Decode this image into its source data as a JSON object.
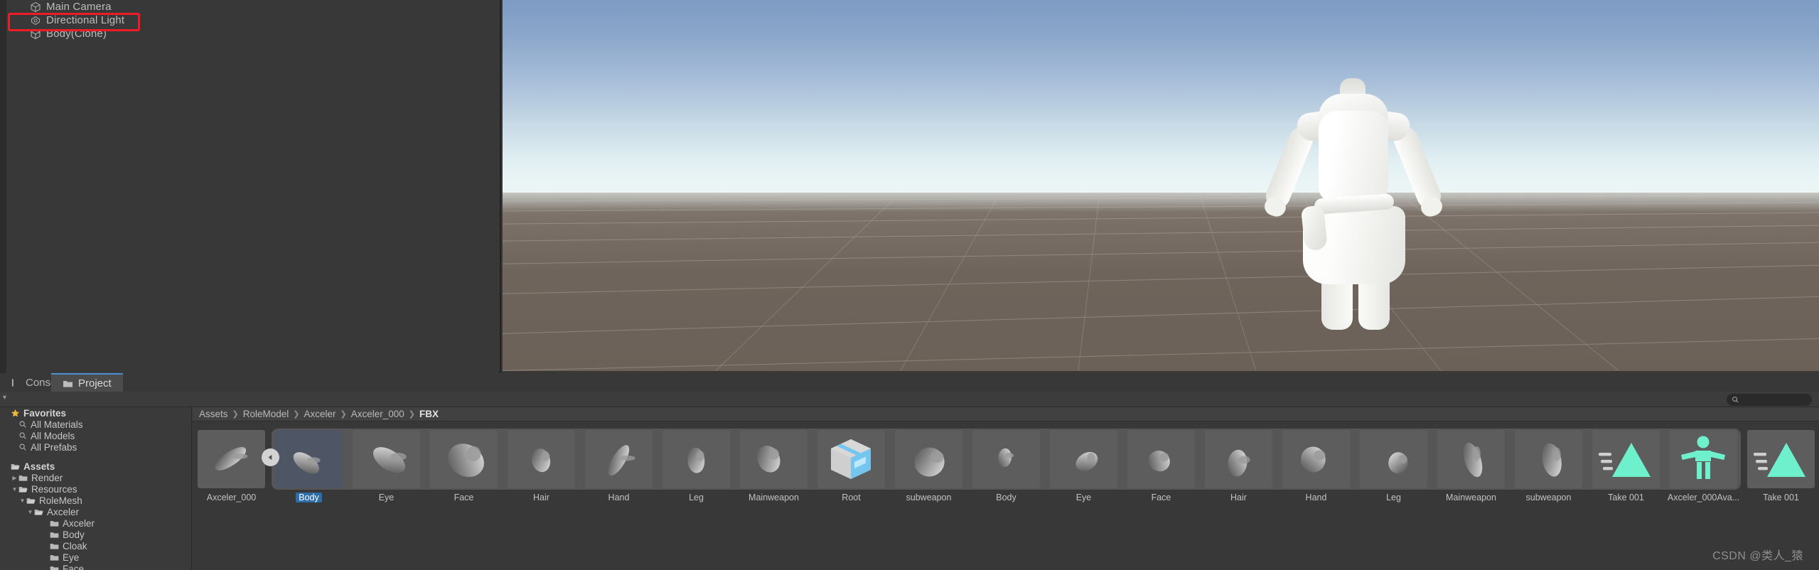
{
  "hierarchy": {
    "items": [
      {
        "label": "Main Camera",
        "icon": "cube-icon"
      },
      {
        "label": "Directional Light",
        "icon": "light-icon"
      },
      {
        "label": "Body(Clone)",
        "icon": "cube-icon",
        "highlighted": true
      }
    ],
    "highlight_color": "#ee1c24"
  },
  "scene": {
    "name": "scene-viewport",
    "content_description": "White untextured 3D female character body mesh in T-pose on grid ground plane with sky gradient"
  },
  "project_panel": {
    "tabs": [
      {
        "label": "Console",
        "active": false,
        "icon": "console-icon"
      },
      {
        "label": "Project",
        "active": true,
        "icon": "folder-icon"
      }
    ],
    "search": {
      "placeholder": "",
      "value": "",
      "icon": "search-icon"
    },
    "tree": [
      {
        "label": "Favorites",
        "icon": "star-icon",
        "depth": 0,
        "bold": true,
        "arrow": ""
      },
      {
        "label": "All Materials",
        "icon": "search-icon",
        "depth": 1,
        "bold": false,
        "arrow": ""
      },
      {
        "label": "All Models",
        "icon": "search-icon",
        "depth": 1,
        "bold": false,
        "arrow": ""
      },
      {
        "label": "All Prefabs",
        "icon": "search-icon",
        "depth": 1,
        "bold": false,
        "arrow": ""
      },
      {
        "label": "",
        "icon": "",
        "depth": 0,
        "bold": false,
        "arrow": ""
      },
      {
        "label": "Assets",
        "icon": "folder-open-icon",
        "depth": 0,
        "bold": true,
        "arrow": ""
      },
      {
        "label": "Render",
        "icon": "folder-icon",
        "depth": 1,
        "bold": false,
        "arrow": "collapsed"
      },
      {
        "label": "Resources",
        "icon": "folder-open-icon",
        "depth": 1,
        "bold": false,
        "arrow": "expanded"
      },
      {
        "label": "RoleMesh",
        "icon": "folder-open-icon",
        "depth": 2,
        "bold": false,
        "arrow": "expanded"
      },
      {
        "label": "Axceler",
        "icon": "folder-open-icon",
        "depth": 3,
        "bold": false,
        "arrow": "expanded"
      },
      {
        "label": "Axceler",
        "icon": "folder-icon",
        "depth": 5,
        "bold": false,
        "arrow": ""
      },
      {
        "label": "Body",
        "icon": "folder-icon",
        "depth": 5,
        "bold": false,
        "arrow": ""
      },
      {
        "label": "Cloak",
        "icon": "folder-icon",
        "depth": 5,
        "bold": false,
        "arrow": ""
      },
      {
        "label": "Eye",
        "icon": "folder-icon",
        "depth": 5,
        "bold": false,
        "arrow": ""
      },
      {
        "label": "Face",
        "icon": "folder-icon",
        "depth": 5,
        "bold": false,
        "arrow": ""
      }
    ],
    "breadcrumb": [
      "Assets",
      "RoleModel",
      "Axceler",
      "Axceler_000",
      "FBX"
    ],
    "assets": [
      {
        "label": "Axceler_000",
        "kind": "mesh-preview",
        "selected": false,
        "grouped": false
      },
      {
        "label": "Body",
        "kind": "mesh-preview",
        "selected": true,
        "grouped": true
      },
      {
        "label": "Eye",
        "kind": "mesh-preview",
        "selected": false,
        "grouped": true
      },
      {
        "label": "Face",
        "kind": "mesh-preview",
        "selected": false,
        "grouped": true
      },
      {
        "label": "Hair",
        "kind": "mesh-preview",
        "selected": false,
        "grouped": true
      },
      {
        "label": "Hand",
        "kind": "mesh-preview",
        "selected": false,
        "grouped": true
      },
      {
        "label": "Leg",
        "kind": "mesh-preview",
        "selected": false,
        "grouped": true
      },
      {
        "label": "Mainweapon",
        "kind": "mesh-preview",
        "selected": false,
        "grouped": true
      },
      {
        "label": "Root",
        "kind": "prefab-icon",
        "selected": false,
        "grouped": true
      },
      {
        "label": "subweapon",
        "kind": "mesh-preview",
        "selected": false,
        "grouped": true
      },
      {
        "label": "Body",
        "kind": "mesh-preview",
        "selected": false,
        "grouped": true
      },
      {
        "label": "Eye",
        "kind": "mesh-preview",
        "selected": false,
        "grouped": true
      },
      {
        "label": "Face",
        "kind": "mesh-preview",
        "selected": false,
        "grouped": true
      },
      {
        "label": "Hair",
        "kind": "mesh-preview",
        "selected": false,
        "grouped": true
      },
      {
        "label": "Hand",
        "kind": "mesh-preview",
        "selected": false,
        "grouped": true
      },
      {
        "label": "Leg",
        "kind": "mesh-preview",
        "selected": false,
        "grouped": true
      },
      {
        "label": "Mainweapon",
        "kind": "mesh-preview",
        "selected": false,
        "grouped": true
      },
      {
        "label": "subweapon",
        "kind": "mesh-preview",
        "selected": false,
        "grouped": true
      },
      {
        "label": "Take 001",
        "kind": "animation-clip-icon",
        "selected": false,
        "grouped": true
      },
      {
        "label": "Axceler_000Ava...",
        "kind": "avatar-icon",
        "selected": false,
        "grouped": true
      },
      {
        "label": "Take 001",
        "kind": "animation-clip-icon",
        "selected": false,
        "grouped": false
      }
    ],
    "slider_knob_icon": "triangle-left-icon",
    "accent_colors": {
      "selection_blue": "#2d6ea8",
      "prefab_blue": "#74c6f0",
      "anim_teal": "#6ef0cc",
      "tab_underline": "#4a8ed6"
    }
  },
  "watermark": {
    "text": "CSDN @类人_猿"
  }
}
